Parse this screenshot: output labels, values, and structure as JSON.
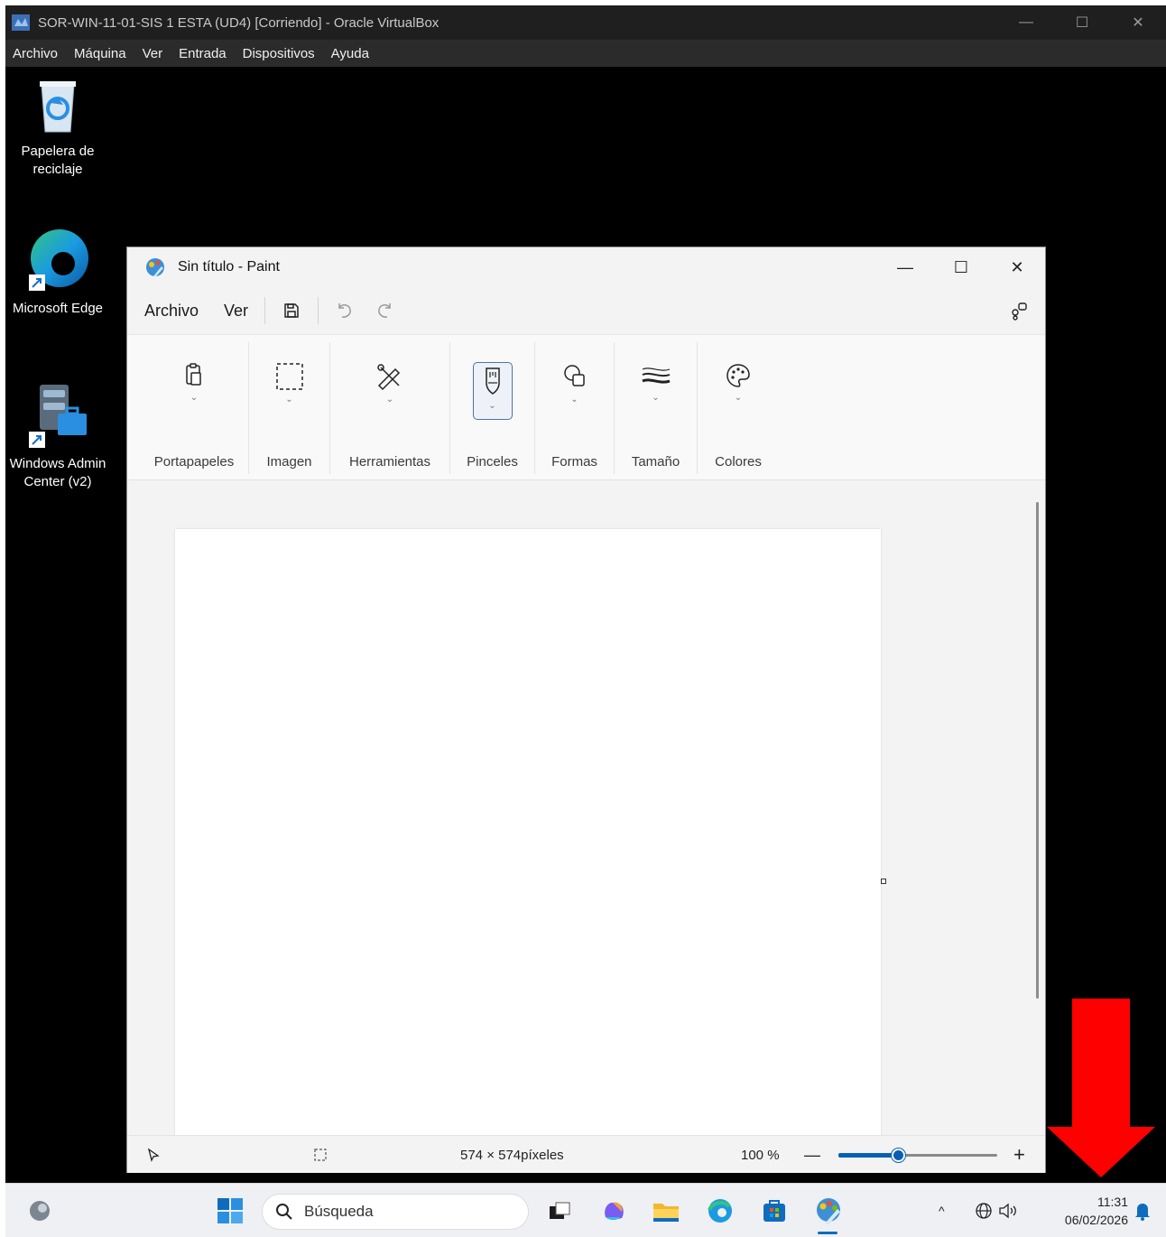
{
  "vbox": {
    "window_title": "SOR-WIN-11-01-SIS 1  ESTA (UD4) [Corriendo] - Oracle VirtualBox",
    "menu": [
      "Archivo",
      "Máquina",
      "Ver",
      "Entrada",
      "Dispositivos",
      "Ayuda"
    ],
    "controls": {
      "minimize": "—",
      "maximize": "☐",
      "close": "✕"
    }
  },
  "desktop": {
    "icons": [
      {
        "name": "recycle-bin",
        "label_line1": "Papelera de",
        "label_line2": "reciclaje"
      },
      {
        "name": "microsoft-edge",
        "label_line1": "Microsoft Edge",
        "label_line2": ""
      },
      {
        "name": "windows-admin-center",
        "label_line1": "Windows Admin",
        "label_line2": "Center (v2)"
      }
    ]
  },
  "paint": {
    "title": "Sin título - Paint",
    "controls": {
      "minimize": "—",
      "maximize": "☐",
      "close": "✕"
    },
    "menu": {
      "file": "Archivo",
      "view": "Ver"
    },
    "ribbon_groups": [
      {
        "name": "clipboard",
        "label": "Portapapeles"
      },
      {
        "name": "image",
        "label": "Imagen"
      },
      {
        "name": "tools",
        "label": "Herramientas"
      },
      {
        "name": "brushes",
        "label": "Pinceles",
        "selected": true
      },
      {
        "name": "shapes",
        "label": "Formas"
      },
      {
        "name": "size",
        "label": "Tamaño"
      },
      {
        "name": "colors",
        "label": "Colores"
      }
    ],
    "status": {
      "dimensions": "574 × 574píxeles",
      "zoom": "100 %",
      "zoom_minus": "—",
      "zoom_plus": "+",
      "zoom_fraction": 0.38
    }
  },
  "taskbar": {
    "search_placeholder": "Búsqueda",
    "tray_chevron": "^",
    "clock_time": "11:31",
    "clock_date": "06/02/2026"
  },
  "colors": {
    "annotation_arrow": "#ff0000",
    "accent": "#0a5fb4"
  }
}
